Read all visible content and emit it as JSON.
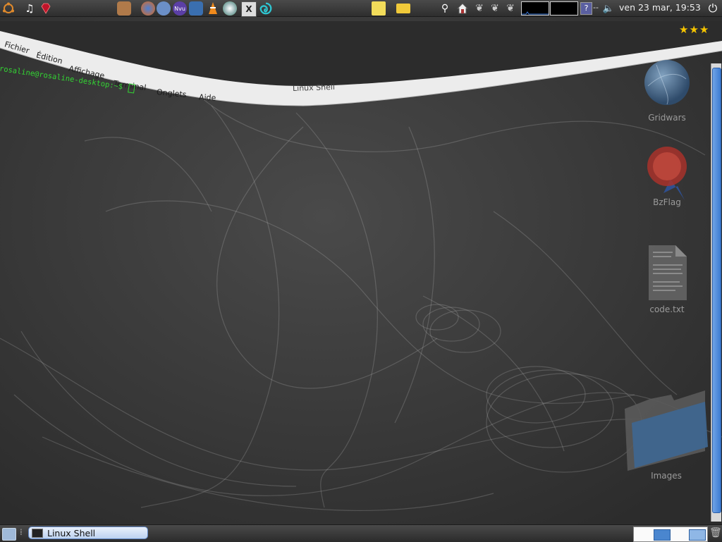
{
  "top_panel": {
    "icons": [
      "ubuntu-menu-icon",
      "music-note-icon",
      "ruby-gem-icon",
      "image-viewer-icon",
      "firefox-icon",
      "mail-icon",
      "nvu-icon",
      "messenger-icon",
      "vlc-icon",
      "cd-burner-icon",
      "xterm-icon",
      "swirl-app-icon",
      "sticky-notes-icon",
      "folder-icon",
      "search-icon",
      "home-icon",
      "gimp-icon"
    ],
    "help_label": "?",
    "volume_text": "--",
    "clock": "ven 23 mar, 19:53"
  },
  "terminal": {
    "menu": [
      "Fichier",
      "Édition",
      "Affichage",
      "Terminal",
      "Onglets",
      "Aide"
    ],
    "title": "Linux Shell",
    "prompt": "rosaline@rosaline-desktop:~$ "
  },
  "desktop_icons": [
    {
      "label": "Gridwars",
      "icon": "gridwars-globe-icon"
    },
    {
      "label": "BzFlag",
      "icon": "bzflag-seal-icon"
    },
    {
      "label": "code.txt",
      "icon": "text-file-icon"
    },
    {
      "label": "Images",
      "icon": "folder-icon"
    }
  ],
  "bottom_panel": {
    "task": "Linux Shell"
  },
  "colors": {
    "prompt": "#33d433",
    "accent": "#4a86cf",
    "panel": "#3a3a3a"
  }
}
